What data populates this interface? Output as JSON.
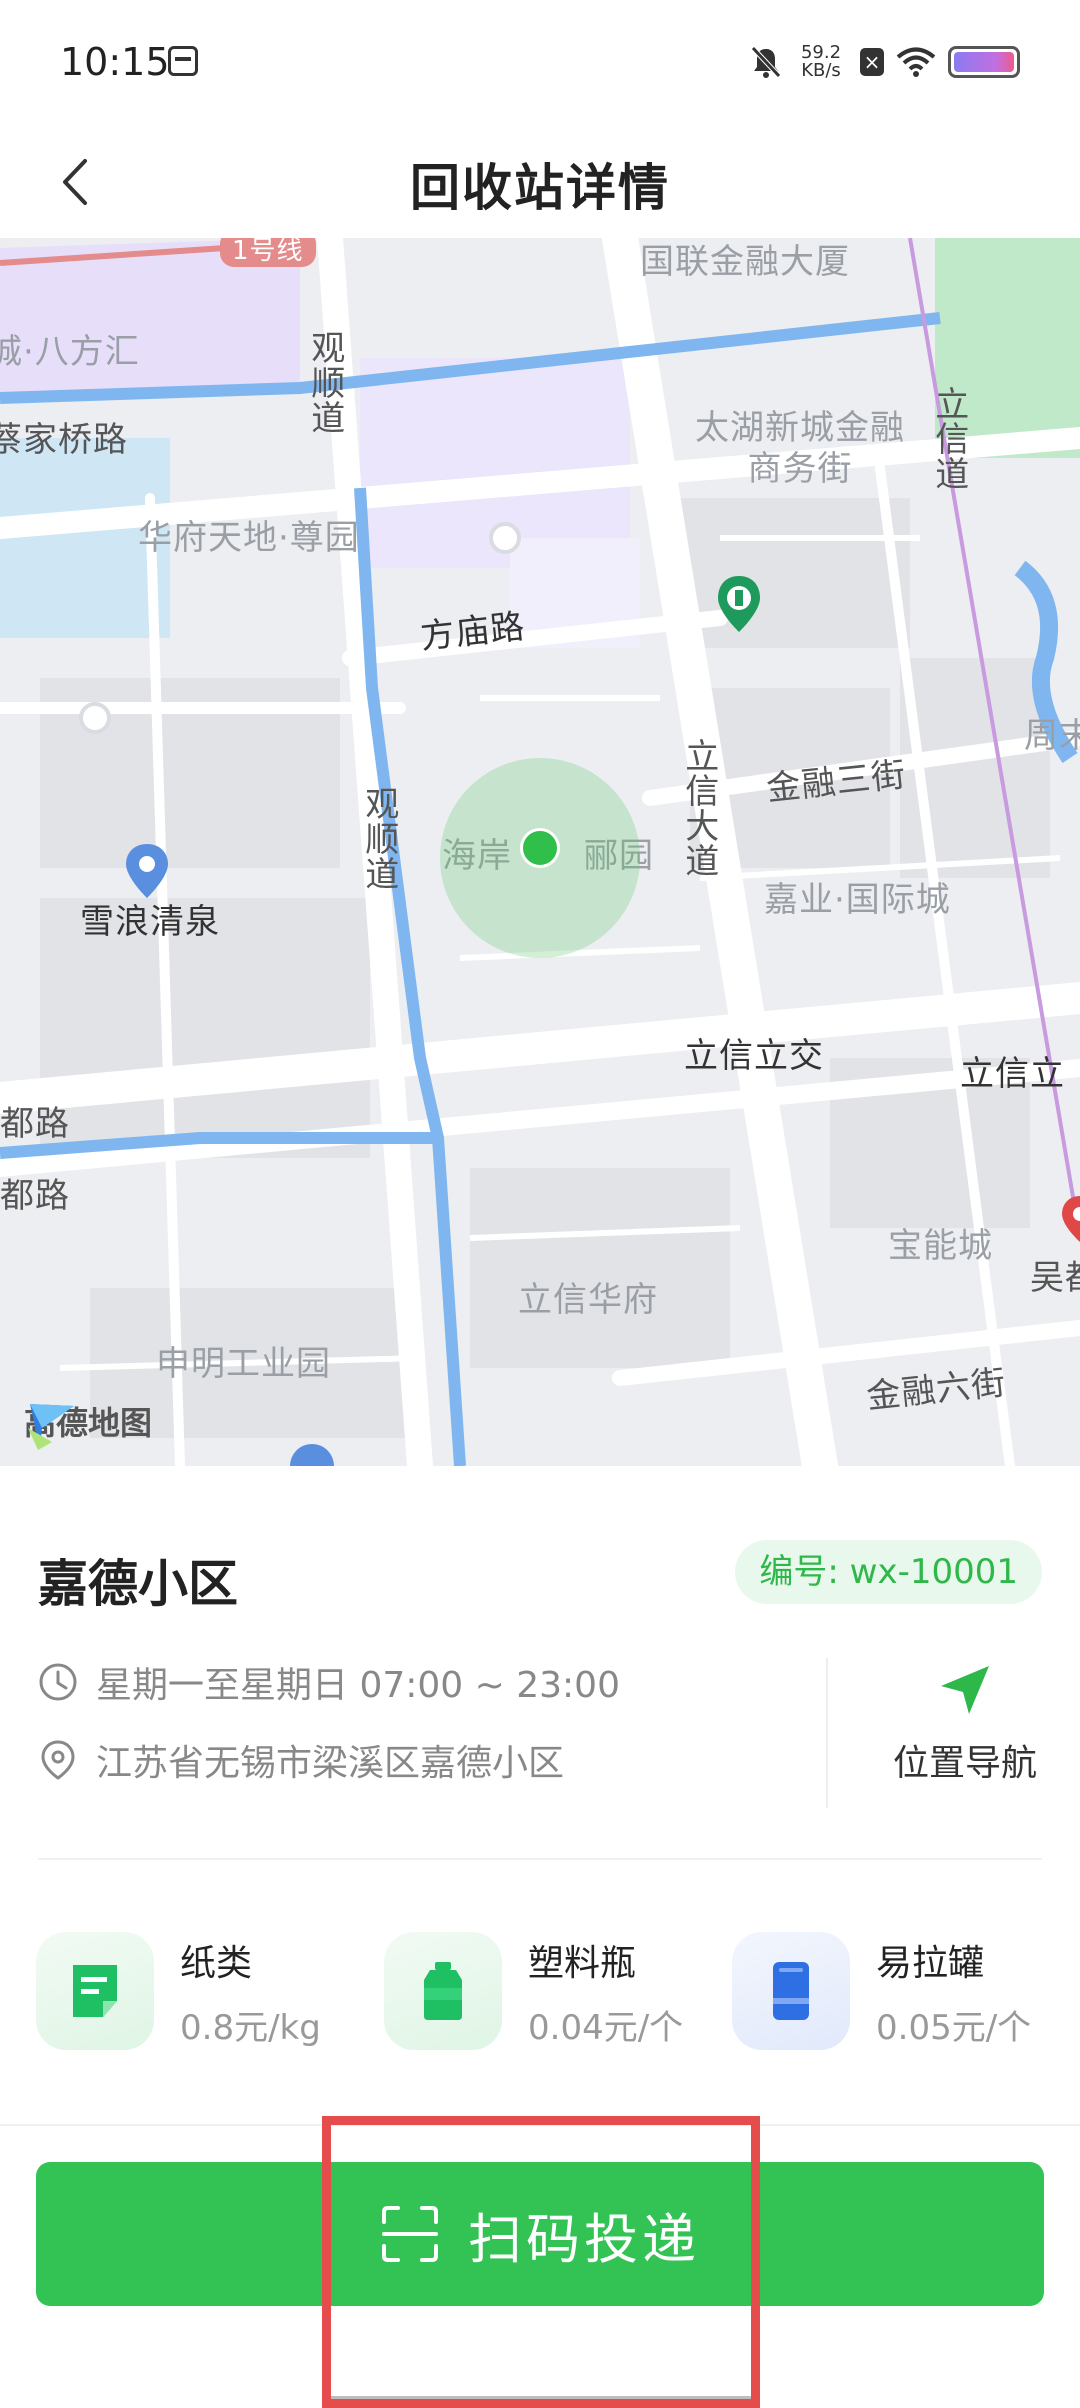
{
  "status_bar": {
    "time": "10:15",
    "net_speed_value": "59.2",
    "net_speed_unit": "KB/s",
    "sim_icon": "x-box-icon",
    "battery_color": "#c16fe0"
  },
  "header": {
    "title": "回收站详情",
    "back_icon": "chevron-left-icon"
  },
  "map": {
    "labels": {
      "line1": "1号线",
      "guolian": "国联金融大厦",
      "bafanghui": "城·八方汇",
      "guanshun_top": "观顺道",
      "caijiaqiao": "蔡家桥路",
      "taihu": "太湖新城金融商务街",
      "lixin_road": "立信道",
      "huafu": "华府天地·尊园",
      "fangmiao": "方庙路",
      "guanshun_mid": "观顺道",
      "lixin_avenue": "立信大道",
      "jinrong3": "金融三街",
      "haian": "海岸",
      "liyuan": "郦园",
      "jiaye": "嘉业·国际城",
      "xuelang": "雪浪清泉",
      "zhou": "周末",
      "lixin_interchange": "立信立交",
      "lixin_right": "立信立",
      "du1": "都路",
      "du2": "都路",
      "baoneng": "宝能城",
      "wuxi": "吴都",
      "lixin_huafu": "立信华府",
      "shenming": "申明工业园",
      "jinrong6": "金融六街",
      "logo": "高德地图"
    },
    "route_color": "#7fb6f0",
    "marker_color": "#2fbf4a"
  },
  "station": {
    "name": "嘉德小区",
    "id_label": "编号: wx-10001",
    "hours": "星期一至星期日 07:00 ~ 23:00",
    "address": "江苏省无锡市梁溪区嘉德小区",
    "nav_label": "位置导航",
    "accent_color": "#2fb84a"
  },
  "waste_types": [
    {
      "name": "纸类",
      "price": "0.8元/kg",
      "icon": "paper-icon"
    },
    {
      "name": "塑料瓶",
      "price": "0.04元/个",
      "icon": "plastic-bottle-icon"
    },
    {
      "name": "易拉罐",
      "price": "0.05元/个",
      "icon": "can-icon"
    }
  ],
  "action": {
    "scan_label": "扫码投递",
    "scan_icon": "scan-icon",
    "button_color": "#33c254",
    "highlight_color": "#e54d4d"
  }
}
